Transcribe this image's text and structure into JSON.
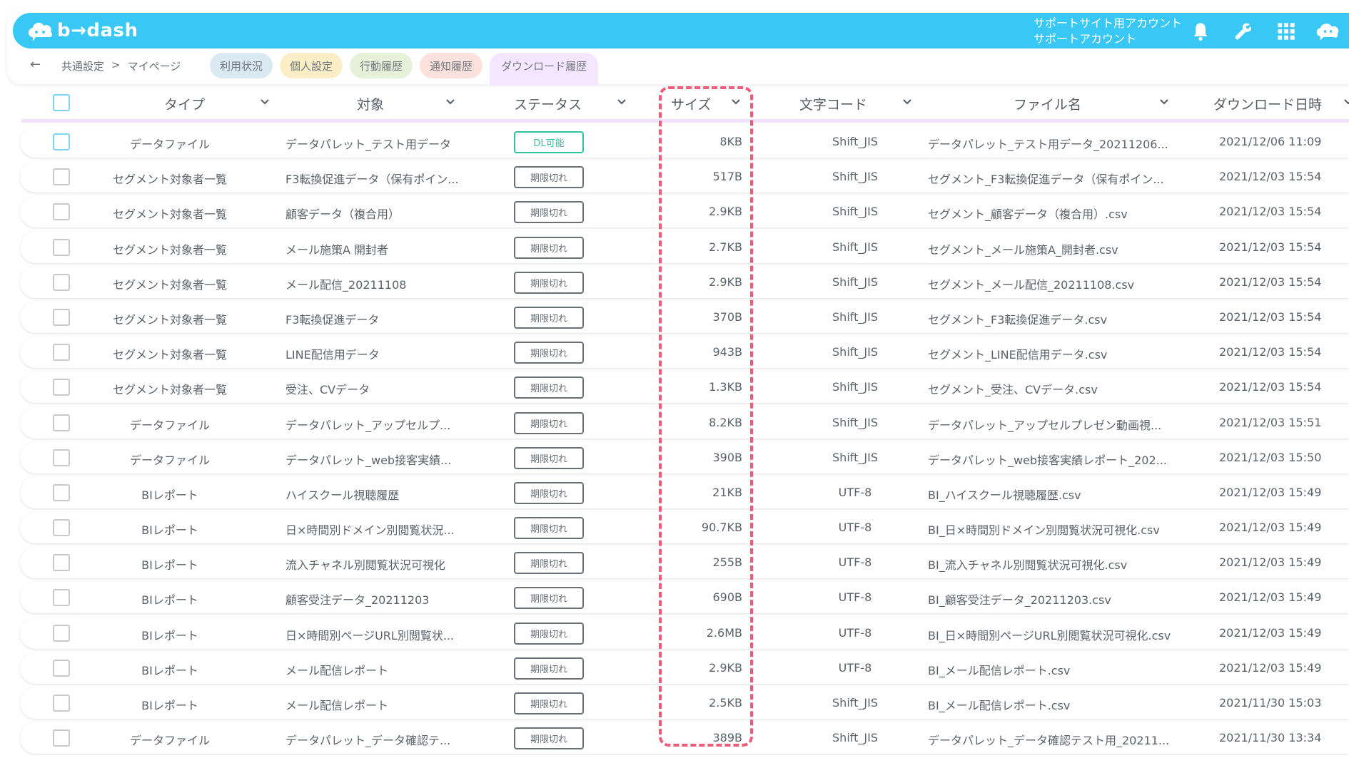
{
  "header": {
    "logo_text": "b→dash",
    "account_line1": "サポートサイト用アカウント",
    "account_line2": "サポートアカウント",
    "icons": [
      "bell-icon",
      "wrench-icon",
      "grid-icon",
      "support-chat-icon"
    ],
    "color": "#39c8f5"
  },
  "nav": {
    "back_label": "←",
    "breadcrumb_root": "共通設定",
    "breadcrumb_sep": ">",
    "breadcrumb_current": "マイページ"
  },
  "tabs": [
    {
      "label": "利用状況",
      "color": "#dbe9f3"
    },
    {
      "label": "個人設定",
      "color": "#fbeec7"
    },
    {
      "label": "行動履歴",
      "color": "#e5f1d9"
    },
    {
      "label": "通知履歴",
      "color": "#fde1dc"
    },
    {
      "label": "ダウンロード履歴",
      "color": "#f4e6ff"
    }
  ],
  "columns": {
    "type": "タイプ",
    "target": "対象",
    "status": "ステータス",
    "size": "サイズ",
    "encoding": "文字コード",
    "filename": "ファイル名",
    "datetime": "ダウンロード日時"
  },
  "rows": [
    {
      "type": "データファイル",
      "target": "データパレット_テスト用データ",
      "status": "DL可能",
      "size": "8KB",
      "encoding": "Shift_JIS",
      "filename": "データパレット_テスト用データ_20211206...",
      "datetime": "2021/12/06 11:09"
    },
    {
      "type": "セグメント対象者一覧",
      "target": "F3転換促進データ（保有ポイン...",
      "status": "期限切れ",
      "size": "517B",
      "encoding": "Shift_JIS",
      "filename": "セグメント_F3転換促進データ（保有ポイン...",
      "datetime": "2021/12/03 15:54"
    },
    {
      "type": "セグメント対象者一覧",
      "target": "顧客データ（複合用）",
      "status": "期限切れ",
      "size": "2.9KB",
      "encoding": "Shift_JIS",
      "filename": "セグメント_顧客データ（複合用）.csv",
      "datetime": "2021/12/03 15:54"
    },
    {
      "type": "セグメント対象者一覧",
      "target": "メール施策A 開封者",
      "status": "期限切れ",
      "size": "2.7KB",
      "encoding": "Shift_JIS",
      "filename": "セグメント_メール施策A_開封者.csv",
      "datetime": "2021/12/03 15:54"
    },
    {
      "type": "セグメント対象者一覧",
      "target": "メール配信_20211108",
      "status": "期限切れ",
      "size": "2.9KB",
      "encoding": "Shift_JIS",
      "filename": "セグメント_メール配信_20211108.csv",
      "datetime": "2021/12/03 15:54"
    },
    {
      "type": "セグメント対象者一覧",
      "target": "F3転換促進データ",
      "status": "期限切れ",
      "size": "370B",
      "encoding": "Shift_JIS",
      "filename": "セグメント_F3転換促進データ.csv",
      "datetime": "2021/12/03 15:54"
    },
    {
      "type": "セグメント対象者一覧",
      "target": "LINE配信用データ",
      "status": "期限切れ",
      "size": "943B",
      "encoding": "Shift_JIS",
      "filename": "セグメント_LINE配信用データ.csv",
      "datetime": "2021/12/03 15:54"
    },
    {
      "type": "セグメント対象者一覧",
      "target": "受注、CVデータ",
      "status": "期限切れ",
      "size": "1.3KB",
      "encoding": "Shift_JIS",
      "filename": "セグメント_受注、CVデータ.csv",
      "datetime": "2021/12/03 15:54"
    },
    {
      "type": "データファイル",
      "target": "データパレット_アップセルプ...",
      "status": "期限切れ",
      "size": "8.2KB",
      "encoding": "Shift_JIS",
      "filename": "データパレット_アップセルプレゼン動画視...",
      "datetime": "2021/12/03 15:51"
    },
    {
      "type": "データファイル",
      "target": "データパレット_web接客実績...",
      "status": "期限切れ",
      "size": "390B",
      "encoding": "Shift_JIS",
      "filename": "データパレット_web接客実績レポート_202...",
      "datetime": "2021/12/03 15:50"
    },
    {
      "type": "BIレポート",
      "target": "ハイスクール視聴履歴",
      "status": "期限切れ",
      "size": "21KB",
      "encoding": "UTF-8",
      "filename": "BI_ハイスクール視聴履歴.csv",
      "datetime": "2021/12/03 15:49"
    },
    {
      "type": "BIレポート",
      "target": "日×時間別ドメイン別閲覧状況...",
      "status": "期限切れ",
      "size": "90.7KB",
      "encoding": "UTF-8",
      "filename": "BI_日×時間別ドメイン別閲覧状況可視化.csv",
      "datetime": "2021/12/03 15:49"
    },
    {
      "type": "BIレポート",
      "target": "流入チャネル別閲覧状況可視化",
      "status": "期限切れ",
      "size": "255B",
      "encoding": "UTF-8",
      "filename": "BI_流入チャネル別閲覧状況可視化.csv",
      "datetime": "2021/12/03 15:49"
    },
    {
      "type": "BIレポート",
      "target": "顧客受注データ_20211203",
      "status": "期限切れ",
      "size": "690B",
      "encoding": "UTF-8",
      "filename": "BI_顧客受注データ_20211203.csv",
      "datetime": "2021/12/03 15:49"
    },
    {
      "type": "BIレポート",
      "target": "日×時間別ページURL別閲覧状...",
      "status": "期限切れ",
      "size": "2.6MB",
      "encoding": "UTF-8",
      "filename": "BI_日×時間別ページURL別閲覧状況可視化.csv",
      "datetime": "2021/12/03 15:49"
    },
    {
      "type": "BIレポート",
      "target": "メール配信レポート",
      "status": "期限切れ",
      "size": "2.9KB",
      "encoding": "UTF-8",
      "filename": "BI_メール配信レポート.csv",
      "datetime": "2021/12/03 15:49"
    },
    {
      "type": "BIレポート",
      "target": "メール配信レポート",
      "status": "期限切れ",
      "size": "2.5KB",
      "encoding": "Shift_JIS",
      "filename": "BI_メール配信レポート.csv",
      "datetime": "2021/11/30 15:03"
    },
    {
      "type": "データファイル",
      "target": "データパレット_データ確認テ...",
      "status": "期限切れ",
      "size": "389B",
      "encoding": "Shift_JIS",
      "filename": "データパレット_データ確認テスト用_20211...",
      "datetime": "2021/11/30 13:34"
    }
  ],
  "colors": {
    "status_ok": "#2fc39e",
    "status_expired": "#6a6f76",
    "highlight": "#f05c78",
    "active_tab": "#f4e6ff"
  }
}
